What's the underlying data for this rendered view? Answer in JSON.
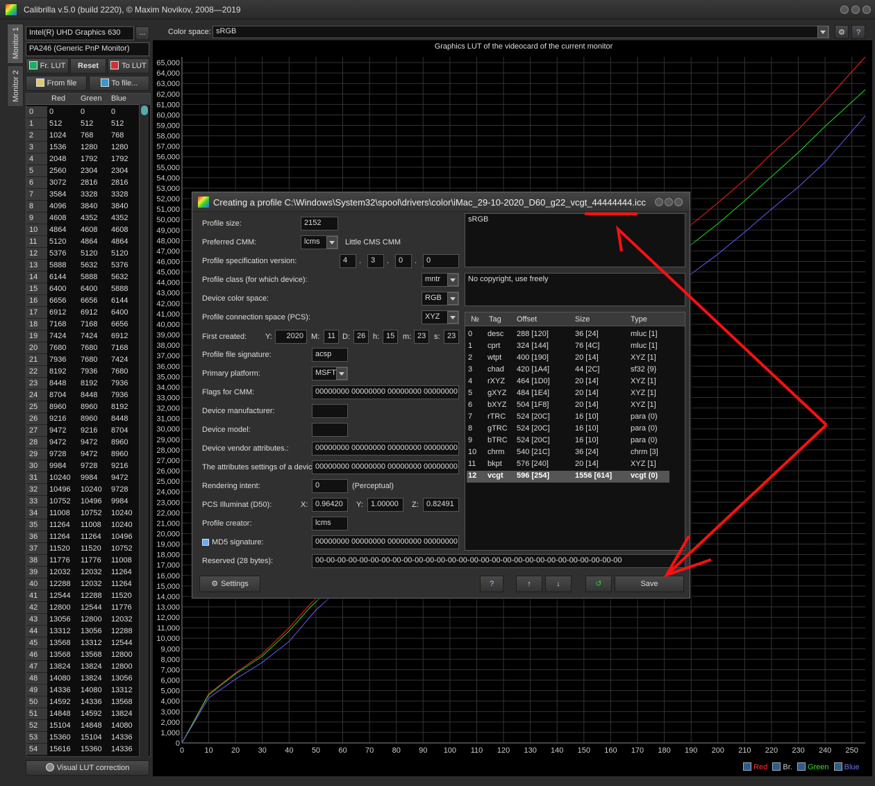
{
  "app": {
    "title": "Calibrilla v.5.0 (build 2220), © Maxim Novikov, 2008—2019"
  },
  "tabs": [
    "Monitor 1",
    "Monitor 2"
  ],
  "left": {
    "gpu": "Intel(R) UHD Graphics 630",
    "more_label": "...",
    "monitor": "PA246 (Generic PnP Monitor)",
    "fr_lut": "Fr. LUT",
    "reset": "Reset",
    "to_lut": "To LUT",
    "from_file": "From file",
    "to_file": "To file...",
    "headers": [
      "Red",
      "Green",
      "Blue"
    ],
    "visual_lut": "Visual LUT correction",
    "rows": [
      [
        0,
        0,
        0
      ],
      [
        512,
        512,
        512
      ],
      [
        1024,
        768,
        768
      ],
      [
        1536,
        1280,
        1280
      ],
      [
        2048,
        1792,
        1792
      ],
      [
        2560,
        2304,
        2304
      ],
      [
        3072,
        2816,
        2816
      ],
      [
        3584,
        3328,
        3328
      ],
      [
        4096,
        3840,
        3840
      ],
      [
        4608,
        4352,
        4352
      ],
      [
        4864,
        4608,
        4608
      ],
      [
        5120,
        4864,
        4864
      ],
      [
        5376,
        5120,
        5120
      ],
      [
        5888,
        5632,
        5376
      ],
      [
        6144,
        5888,
        5632
      ],
      [
        6400,
        6400,
        5888
      ],
      [
        6656,
        6656,
        6144
      ],
      [
        6912,
        6912,
        6400
      ],
      [
        7168,
        7168,
        6656
      ],
      [
        7424,
        7424,
        6912
      ],
      [
        7680,
        7680,
        7168
      ],
      [
        7936,
        7680,
        7424
      ],
      [
        8192,
        7936,
        7680
      ],
      [
        8448,
        8192,
        7936
      ],
      [
        8704,
        8448,
        7936
      ],
      [
        8960,
        8960,
        8192
      ],
      [
        9216,
        8960,
        8448
      ],
      [
        9472,
        9216,
        8704
      ],
      [
        9472,
        9472,
        8960
      ],
      [
        9728,
        9472,
        8960
      ],
      [
        9984,
        9728,
        9216
      ],
      [
        10240,
        9984,
        9472
      ],
      [
        10496,
        10240,
        9728
      ],
      [
        10752,
        10496,
        9984
      ],
      [
        11008,
        10752,
        10240
      ],
      [
        11264,
        11008,
        10240
      ],
      [
        11264,
        11264,
        10496
      ],
      [
        11520,
        11520,
        10752
      ],
      [
        11776,
        11776,
        11008
      ],
      [
        12032,
        12032,
        11264
      ],
      [
        12288,
        12032,
        11264
      ],
      [
        12544,
        12288,
        11520
      ],
      [
        12800,
        12544,
        11776
      ],
      [
        13056,
        12800,
        12032
      ],
      [
        13312,
        13056,
        12288
      ],
      [
        13568,
        13312,
        12544
      ],
      [
        13568,
        13568,
        12800
      ],
      [
        13824,
        13824,
        12800
      ],
      [
        14080,
        13824,
        13056
      ],
      [
        14336,
        14080,
        13312
      ],
      [
        14592,
        14336,
        13568
      ],
      [
        14848,
        14592,
        13824
      ],
      [
        15104,
        14848,
        14080
      ],
      [
        15360,
        15104,
        14336
      ],
      [
        15616,
        15360,
        14336
      ]
    ]
  },
  "colorspace": {
    "label": "Color space:",
    "value": "sRGB"
  },
  "chart_data": {
    "type": "line",
    "title": "Graphics LUT of the videocard of the current monitor",
    "xlim": [
      0,
      255
    ],
    "ylim": [
      0,
      65535
    ],
    "xticks": [
      0,
      10,
      20,
      30,
      40,
      50,
      60,
      70,
      80,
      90,
      100,
      110,
      120,
      130,
      140,
      150,
      160,
      170,
      180,
      190,
      200,
      210,
      220,
      230,
      240,
      250
    ],
    "yticks": [
      0,
      1000,
      2000,
      3000,
      4000,
      5000,
      6000,
      7000,
      8000,
      9000,
      10000,
      11000,
      12000,
      13000,
      14000,
      15000,
      16000,
      17000,
      18000,
      19000,
      20000,
      21000,
      22000,
      23000,
      24000,
      25000,
      26000,
      27000,
      28000,
      29000,
      30000,
      31000,
      32000,
      33000,
      34000,
      35000,
      36000,
      37000,
      38000,
      39000,
      40000,
      41000,
      42000,
      43000,
      44000,
      45000,
      46000,
      47000,
      48000,
      49000,
      50000,
      51000,
      52000,
      53000,
      54000,
      55000,
      56000,
      57000,
      58000,
      59000,
      60000,
      61000,
      62000,
      63000,
      64000,
      65000
    ],
    "ytick_labels": [
      "0",
      "1,000",
      "2,000",
      "3,000",
      "4,000",
      "5,000",
      "6,000",
      "7,000",
      "8,000",
      "9,000",
      "10,000",
      "11,000",
      "12,000",
      "13,000",
      "14,000",
      "15,000",
      "16,000",
      "17,000",
      "18,000",
      "19,000",
      "20,000",
      "21,000",
      "22,000",
      "23,000",
      "24,000",
      "25,000",
      "26,000",
      "27,000",
      "28,000",
      "29,000",
      "30,000",
      "31,000",
      "32,000",
      "33,000",
      "34,000",
      "35,000",
      "36,000",
      "37,000",
      "38,000",
      "39,000",
      "40,000",
      "41,000",
      "42,000",
      "43,000",
      "44,000",
      "45,000",
      "46,000",
      "47,000",
      "48,000",
      "49,000",
      "50,000",
      "51,000",
      "52,000",
      "53,000",
      "54,000",
      "55,000",
      "56,000",
      "57,000",
      "58,000",
      "59,000",
      "60,000",
      "61,000",
      "62,000",
      "63,000",
      "64,000",
      "65,000"
    ],
    "grid": true,
    "series": [
      {
        "name": "Red",
        "color": "#ff2020",
        "x": [
          0,
          10,
          20,
          30,
          40,
          48,
          190,
          200,
          210,
          220,
          230,
          240,
          255
        ],
        "y": [
          0,
          4700,
          6700,
          8500,
          11000,
          13300,
          49500,
          51600,
          53800,
          56300,
          58600,
          61300,
          65535
        ]
      },
      {
        "name": "Green",
        "color": "#20e020",
        "x": [
          0,
          10,
          20,
          30,
          40,
          48,
          190,
          200,
          210,
          220,
          230,
          240,
          255
        ],
        "y": [
          0,
          4600,
          6600,
          8300,
          10700,
          13000,
          47600,
          49600,
          51800,
          54100,
          56400,
          58900,
          62400
        ]
      },
      {
        "name": "Blue",
        "color": "#6060ff",
        "x": [
          0,
          10,
          20,
          30,
          40,
          50,
          190,
          200,
          210,
          220,
          230,
          240,
          255
        ],
        "y": [
          0,
          4300,
          6100,
          7700,
          9700,
          12700,
          44800,
          46700,
          48800,
          51000,
          53100,
          55500,
          59900
        ]
      }
    ],
    "legend": [
      {
        "label": "Red",
        "color": "#ff2020"
      },
      {
        "label": "Br.",
        "color": "#cccccc"
      },
      {
        "label": "Green",
        "color": "#20e020"
      },
      {
        "label": "Blue",
        "color": "#6060ff"
      }
    ]
  },
  "dialog": {
    "title": "Creating a profile C:\\Windows\\System32\\spool\\drivers\\color\\iMac_29-10-2020_D60_g22_vcgt_44444444.icc",
    "profile_size": {
      "label": "Profile size:",
      "value": "2152"
    },
    "cmm": {
      "label": "Preferred CMM:",
      "value": "lcms",
      "desc": "Little CMS CMM"
    },
    "spec_version": {
      "label": "Profile specification version:",
      "parts": [
        "4",
        "3",
        "0",
        "0"
      ]
    },
    "profile_class": {
      "label": "Profile class (for which device):",
      "value": "mntr"
    },
    "color_space": {
      "label": "Device color space:",
      "value": "RGB"
    },
    "pcs": {
      "label": "Profile connection space (PCS):",
      "value": "XYZ"
    },
    "created": {
      "label": "First created:",
      "Y": "2020",
      "M": "11",
      "D": "26",
      "h": "15",
      "m": "23",
      "s": "23",
      "labels": [
        "Y:",
        "M:",
        "D:",
        "h:",
        "m:",
        "s:"
      ]
    },
    "signature": {
      "label": "Profile file signature:",
      "value": "acsp"
    },
    "platform": {
      "label": "Primary platform:",
      "value": "MSFT"
    },
    "flags": {
      "label": "Flags for CMM:",
      "value": "00000000 00000000 00000000 00000000"
    },
    "manufacturer": {
      "label": "Device manufacturer:",
      "value": ""
    },
    "model": {
      "label": "Device model:",
      "value": ""
    },
    "vendor_attr": {
      "label": "Device vendor attributes.:",
      "value": "00000000 00000000 00000000 00000000"
    },
    "attr_settings": {
      "label": "The attributes settings of a device",
      "value": "00000000 00000000 00000000 00000000"
    },
    "intent": {
      "label": "Rendering intent:",
      "value": "0",
      "desc": "(Perceptual)"
    },
    "illuminant": {
      "label": "PCS Illuminat (D50):",
      "X": "0.96420",
      "Y": "1.00000",
      "Z": "0.82491",
      "labels": [
        "X:",
        "Y:",
        "Z:"
      ]
    },
    "creator": {
      "label": "Profile creator:",
      "value": "lcms"
    },
    "md5": {
      "label": "MD5 signature:",
      "value": "00000000 00000000 00000000 00000000"
    },
    "reserved": {
      "label": "Reserved (28 bytes):",
      "value": "00-00-00-00-00-00-00-00-00-00-00-00-00-00-00-00-00-00-00-00-00-00-00-00-00-00-00-00"
    },
    "desc_text": "sRGB",
    "copyright_text": "No copyright, use freely",
    "tag_headers": [
      "№",
      "Tag",
      "Offset",
      "Size",
      "Type"
    ],
    "tags": [
      [
        "0",
        "desc",
        "288 [120]",
        "36 [24]",
        "mluc [1]"
      ],
      [
        "1",
        "cprt",
        "324 [144]",
        "76 [4C]",
        "mluc [1]"
      ],
      [
        "2",
        "wtpt",
        "400 [190]",
        "20 [14]",
        "XYZ  [1]"
      ],
      [
        "3",
        "chad",
        "420 [1A4]",
        "44 [2C]",
        "sf32 {9}"
      ],
      [
        "4",
        "rXYZ",
        "464 [1D0]",
        "20 [14]",
        "XYZ  [1]"
      ],
      [
        "5",
        "gXYZ",
        "484 [1E4]",
        "20 [14]",
        "XYZ  [1]"
      ],
      [
        "6",
        "bXYZ",
        "504 [1F8]",
        "20 [14]",
        "XYZ  [1]"
      ],
      [
        "7",
        "rTRC",
        "524 [20C]",
        "16 [10]",
        "para (0)"
      ],
      [
        "8",
        "gTRC",
        "524 [20C]",
        "16 [10]",
        "para (0)"
      ],
      [
        "9",
        "bTRC",
        "524 [20C]",
        "16 [10]",
        "para (0)"
      ],
      [
        "10",
        "chrm",
        "540 [21C]",
        "36 [24]",
        "chrm [3]"
      ],
      [
        "11",
        "bkpt",
        "576 [240]",
        "20 [14]",
        "XYZ  [1]"
      ],
      [
        "12",
        "vcgt",
        "596 [254]",
        "1556 [614]",
        "vcgt (0)"
      ]
    ],
    "settings_label": "Settings",
    "help_label": "?",
    "up_label": "↑",
    "down_label": "↓",
    "save_label": "Save"
  }
}
